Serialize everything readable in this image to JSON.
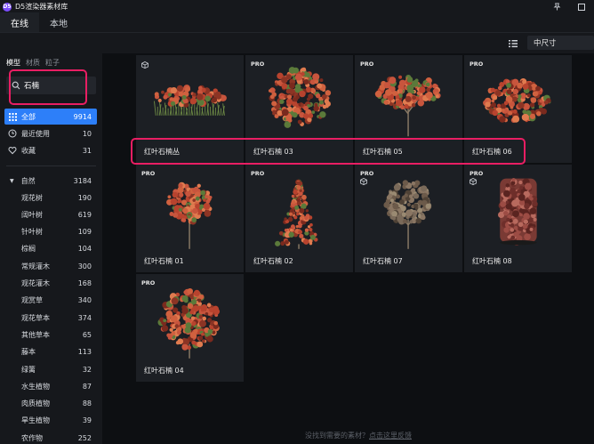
{
  "window": {
    "title": "D5渲染器素材库",
    "logo": "D5"
  },
  "tabs": [
    {
      "label": "在线",
      "active": true
    },
    {
      "label": "本地",
      "active": false
    }
  ],
  "toolbar": {
    "size_select": "中尺寸"
  },
  "sidebar": {
    "tabs": [
      {
        "label": "模型",
        "active": true
      },
      {
        "label": "材质",
        "active": false
      },
      {
        "label": "粒子",
        "active": false
      }
    ],
    "search_value": "石楠",
    "nav": [
      {
        "label": "全部",
        "count": "9914",
        "active": true,
        "icon": "grid-icon"
      },
      {
        "label": "最近使用",
        "count": "10",
        "active": false,
        "icon": "clock-icon"
      },
      {
        "label": "收藏",
        "count": "31",
        "active": false,
        "icon": "heart-icon"
      }
    ],
    "parent": {
      "label": "自然",
      "count": "3184"
    },
    "categories": [
      {
        "label": "观花树",
        "count": "190"
      },
      {
        "label": "阔叶树",
        "count": "619"
      },
      {
        "label": "针叶树",
        "count": "109"
      },
      {
        "label": "棕榈",
        "count": "104"
      },
      {
        "label": "常规灌木",
        "count": "300"
      },
      {
        "label": "观花灌木",
        "count": "168"
      },
      {
        "label": "观赏草",
        "count": "340"
      },
      {
        "label": "观花草本",
        "count": "374"
      },
      {
        "label": "其他草本",
        "count": "65"
      },
      {
        "label": "藤本",
        "count": "113"
      },
      {
        "label": "绿篱",
        "count": "32"
      },
      {
        "label": "水生植物",
        "count": "87"
      },
      {
        "label": "肉质植物",
        "count": "88"
      },
      {
        "label": "旱生植物",
        "count": "39"
      },
      {
        "label": "农作物",
        "count": "252"
      }
    ]
  },
  "cards": [
    {
      "label": "红叶石楠丛",
      "badge": "",
      "cube": true,
      "shape": "hedge-low"
    },
    {
      "label": "红叶石楠 03",
      "badge": "PRO",
      "cube": false,
      "shape": "bush-big"
    },
    {
      "label": "红叶石楠 05",
      "badge": "PRO",
      "cube": false,
      "shape": "tree-wide"
    },
    {
      "label": "红叶石楠 06",
      "badge": "PRO",
      "cube": false,
      "shape": "dome"
    },
    {
      "label": "红叶石楠 01",
      "badge": "PRO",
      "cube": false,
      "shape": "tree-round"
    },
    {
      "label": "红叶石楠 02",
      "badge": "PRO",
      "cube": false,
      "shape": "cone"
    },
    {
      "label": "红叶石楠 07",
      "badge": "PRO",
      "cube": true,
      "shape": "tree-grey"
    },
    {
      "label": "红叶石楠 08",
      "badge": "PRO",
      "cube": true,
      "shape": "cylinder"
    },
    {
      "label": "红叶石楠 04",
      "badge": "PRO",
      "cube": false,
      "shape": "bush-tall"
    }
  ],
  "footer": {
    "text": "没找到需要的素材？",
    "link": "点击这里反馈"
  },
  "colors": {
    "accent": "#2d7ff9",
    "highlight": "#e91e63",
    "foliage": "#c8553d",
    "leaf_green": "#5b7a3a"
  }
}
